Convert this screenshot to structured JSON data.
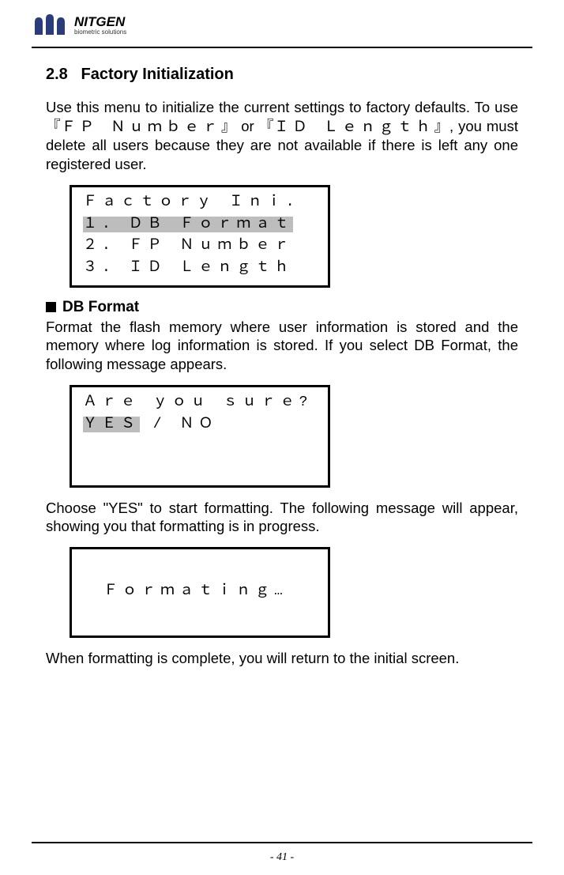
{
  "header": {
    "logo_main": "NITGEN",
    "logo_sub": "biometric solutions"
  },
  "section": {
    "number": "2.8",
    "title": "Factory Initialization",
    "intro_a": "Use this menu to initialize the current settings to factory defaults. To use『",
    "intro_fp": "ＦＰ Ｎｕｍｂｅｒ",
    "intro_b": "』 or 『",
    "intro_id": "ＩＤ Ｌｅｎｇｔｈ",
    "intro_c": "』, you must delete all users because they are not available if there is left any one registered user."
  },
  "lcd1": {
    "l1": "Ｆａｃｔｏｒｙ Ｉｎｉ.",
    "l2": "１. ＤＢ Ｆｏｒｍａｔ",
    "l3": "２. ＦＰ Ｎｕｍｂｅｒ",
    "l4": "３. ＩＤ Ｌｅｎｇｔｈ"
  },
  "db_format": {
    "heading": "DB Format",
    "para1": "Format the flash memory where user information is stored and the memory where log information is stored. If you select DB Format, the following message appears.",
    "para2": "Choose \"YES\" to start formatting. The following message will appear, showing you that formatting is in progress.",
    "para3": "When formatting is complete, you will return to the initial screen."
  },
  "lcd2": {
    "l1": "Ａｒｅ ｙｏｕ ｓｕｒｅ?",
    "l2a": "ＹＥＳ",
    "l2b": " / ＮＯ"
  },
  "lcd3": {
    "l1": "Ｆｏｒｍａｔｉｎｇ…"
  },
  "footer": {
    "page": "- 41 -"
  }
}
